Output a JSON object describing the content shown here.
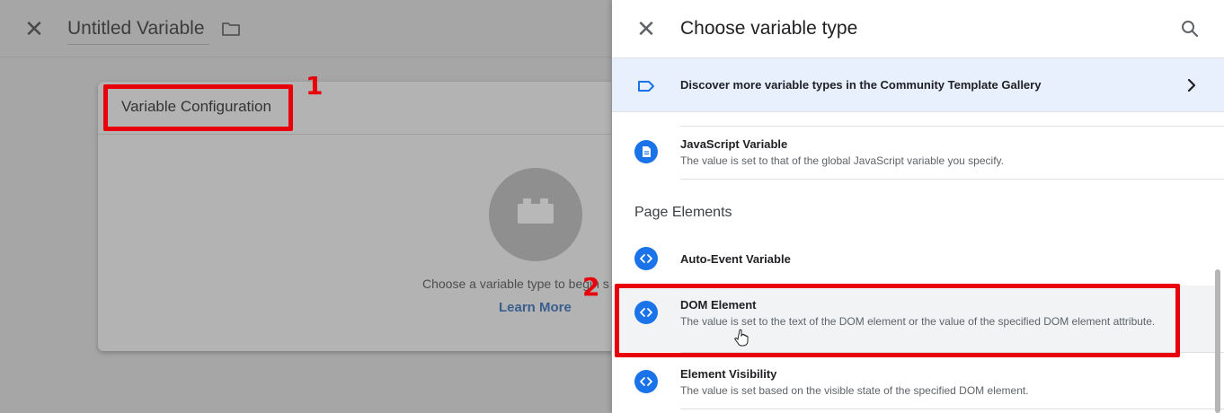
{
  "editor": {
    "title": "Untitled Variable",
    "card_title": "Variable Configuration",
    "choose_prompt": "Choose a variable type to begin s",
    "learn_more": "Learn More"
  },
  "panel": {
    "title": "Choose variable type",
    "discover": "Discover more variable types in the Community Template Gallery",
    "section_page_elements": "Page Elements",
    "items": [
      {
        "title": "JavaScript Variable",
        "desc": "The value is set to that of the global JavaScript variable you specify.",
        "icon": "document-icon"
      },
      {
        "title": "Auto-Event Variable",
        "desc": "",
        "icon": "code-icon"
      },
      {
        "title": "DOM Element",
        "desc": "The value is set to the text of the DOM element or the value of the specified DOM element attribute.",
        "icon": "code-icon"
      },
      {
        "title": "Element Visibility",
        "desc": "The value is set based on the visible state of the specified DOM element.",
        "icon": "code-icon"
      }
    ]
  },
  "annotations": {
    "badge_1": "1",
    "badge_2": "2",
    "color": "#e8000b"
  },
  "colors": {
    "accent": "#1a73e8",
    "discover_bg": "#e8f0fe",
    "overlay": "#a6a6a6"
  }
}
